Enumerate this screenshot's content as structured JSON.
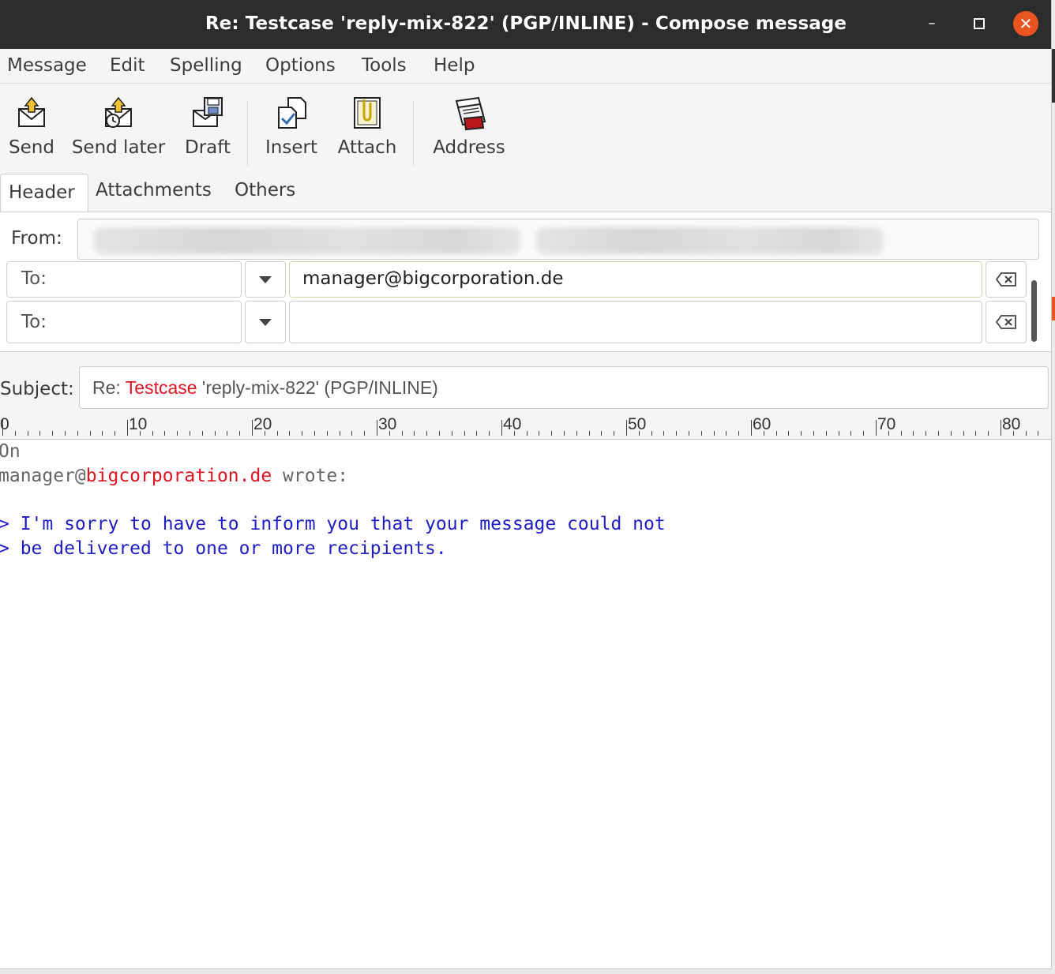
{
  "window": {
    "title": "Re: Testcase 'reply-mix-822' (PGP/INLINE) - Compose message",
    "minimize_glyph": "–",
    "close_glyph": "✕"
  },
  "menu": {
    "items": [
      "Message",
      "Edit",
      "Spelling",
      "Options",
      "Tools",
      "Help"
    ]
  },
  "toolbar": {
    "send": "Send",
    "send_later": "Send later",
    "draft": "Draft",
    "insert": "Insert",
    "attach": "Attach",
    "address": "Address"
  },
  "tabs": {
    "header": "Header",
    "attachments": "Attachments",
    "others": "Others"
  },
  "header": {
    "from_label": "From:",
    "recipients": [
      {
        "type": "To:",
        "address": "manager@bigcorporation.de"
      },
      {
        "type": "To:",
        "address": ""
      }
    ]
  },
  "subject": {
    "label": "Subject:",
    "prefix": "Re: ",
    "highlight": "Testcase",
    "rest": " 'reply-mix-822' (PGP/INLINE)"
  },
  "ruler": {
    "labels": [
      "0",
      "10",
      "20",
      "30",
      "40",
      "50",
      "60",
      "70",
      "80"
    ]
  },
  "body": {
    "line1": "On",
    "line2_user": "manager@",
    "line2_domain": "bigcorporation.de",
    "line2_suffix": " wrote:",
    "quote1": "> I'm sorry to have to inform you that your message could not",
    "quote2": "> be delivered to one or more recipients."
  },
  "colors": {
    "titlebar": "#2c2c2c",
    "close_button": "#e95420",
    "misspelled_highlight": "#e0141e",
    "quote_text": "#1e1ec8"
  }
}
